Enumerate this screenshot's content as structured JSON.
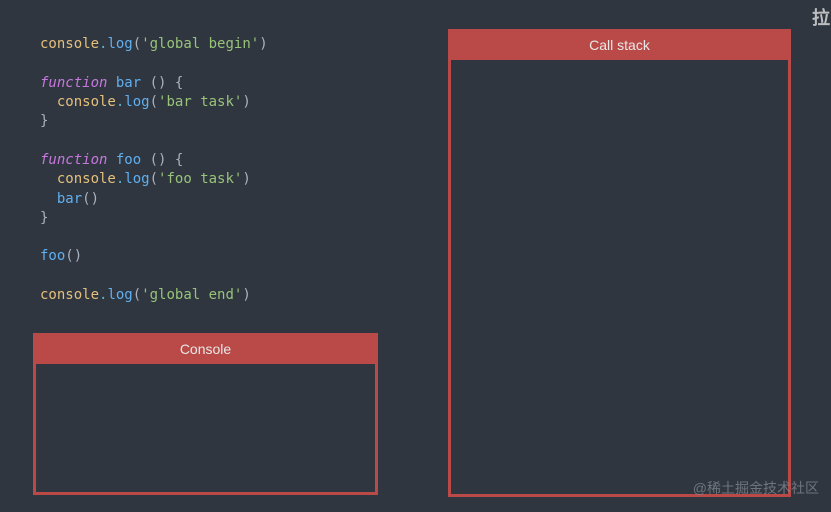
{
  "code": {
    "line1_obj": "console",
    "line1_dot": ".",
    "line1_method": "log",
    "line1_open": "(",
    "line1_str": "'global begin'",
    "line1_close": ")",
    "line3_kw": "function",
    "line3_fn": " bar ",
    "line3_rest": "() {",
    "line4_indent": "  ",
    "line4_obj": "console",
    "line4_dot": ".",
    "line4_method": "log",
    "line4_open": "(",
    "line4_str": "'bar task'",
    "line4_close": ")",
    "line5_close": "}",
    "line7_kw": "function",
    "line7_fn": " foo ",
    "line7_rest": "() {",
    "line8_indent": "  ",
    "line8_obj": "console",
    "line8_dot": ".",
    "line8_method": "log",
    "line8_open": "(",
    "line8_str": "'foo task'",
    "line8_close": ")",
    "line9_indent": "  ",
    "line9_call": "bar",
    "line9_parens": "()",
    "line10_close": "}",
    "line12_call": "foo",
    "line12_parens": "()",
    "line14_obj": "console",
    "line14_dot": ".",
    "line14_method": "log",
    "line14_open": "(",
    "line14_str": "'global end'",
    "line14_close": ")"
  },
  "panels": {
    "console_title": "Console",
    "callstack_title": "Call stack"
  },
  "watermark": {
    "top": "拉",
    "bottom": "@稀土掘金技术社区"
  }
}
